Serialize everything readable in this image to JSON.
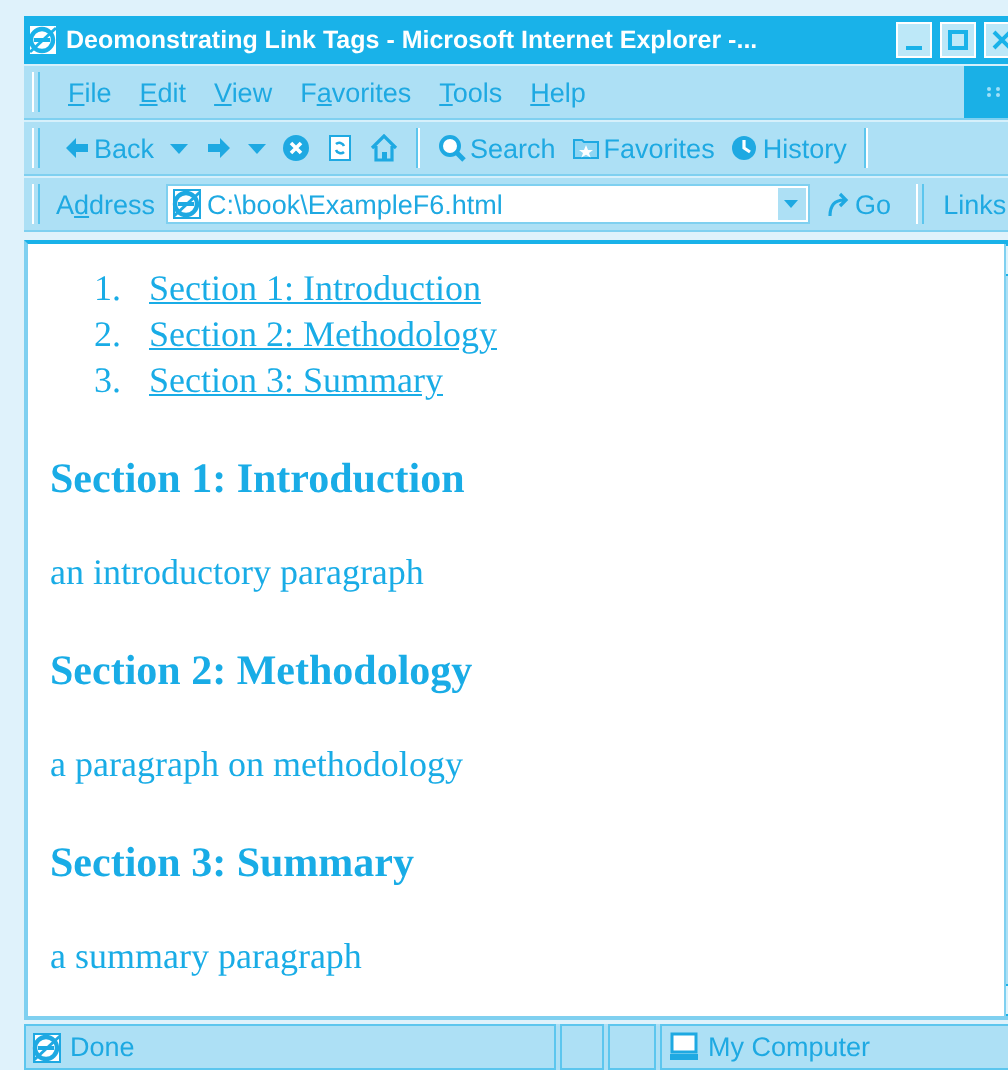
{
  "window": {
    "title": "Deomonstrating Link Tags - Microsoft Internet Explorer -..."
  },
  "menu": [
    {
      "key": "F",
      "after": "ile"
    },
    {
      "key": "E",
      "after": "dit"
    },
    {
      "key": "V",
      "after": "iew"
    },
    {
      "before": "F",
      "key": "a",
      "after": "vorites"
    },
    {
      "key": "T",
      "after": "ools"
    },
    {
      "key": "H",
      "after": "elp"
    }
  ],
  "toolbar": [
    {
      "kind": "back",
      "label": "Back"
    },
    {
      "kind": "dropdown"
    },
    {
      "kind": "forward"
    },
    {
      "kind": "dropdown"
    },
    {
      "kind": "stop"
    },
    {
      "kind": "refresh"
    },
    {
      "kind": "home"
    },
    {
      "kind": "separator"
    },
    {
      "kind": "search",
      "label": "Search"
    },
    {
      "kind": "favorites",
      "label": "Favorites"
    },
    {
      "kind": "history",
      "label": "History"
    },
    {
      "kind": "separator"
    }
  ],
  "address_bar": {
    "label": {
      "before": "A",
      "key": "d",
      "after": "dress"
    },
    "value": "C:\\book\\ExampleF6.html",
    "go": "Go",
    "links": "Links"
  },
  "page": {
    "contents": [
      {
        "number": "1.",
        "link": "Section 1: Introduction"
      },
      {
        "number": "2.",
        "link": "Section 2: Methodology"
      },
      {
        "number": "3.",
        "link": "Section 3: Summary"
      }
    ],
    "sections": [
      {
        "heading": "Section 1: Introduction",
        "paragraph": "an introductory paragraph"
      },
      {
        "heading": "Section 2: Methodology",
        "paragraph": "a paragraph on methodology"
      },
      {
        "heading": "Section 3: Summary",
        "paragraph": "a summary paragraph"
      }
    ]
  },
  "status_bar": {
    "text": "Done",
    "zone": "My Computer"
  }
}
